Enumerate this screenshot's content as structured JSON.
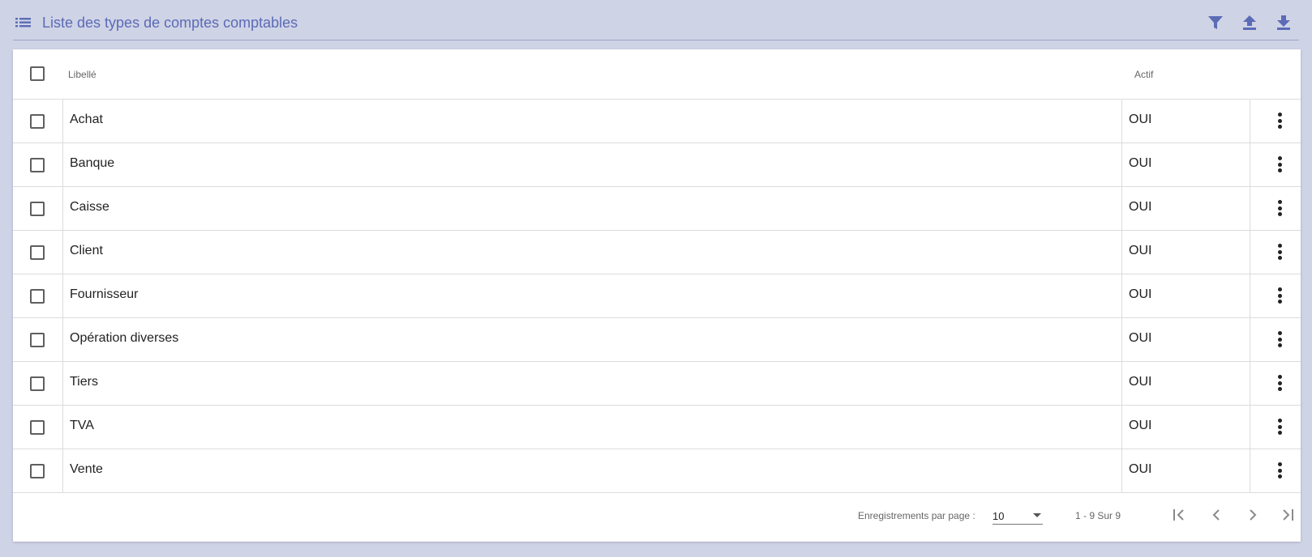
{
  "header": {
    "title": "Liste des types de comptes comptables",
    "icons": [
      "list-icon",
      "filter-icon",
      "upload-icon",
      "download-icon"
    ],
    "accent": "#5b6bb6"
  },
  "table": {
    "columns": [
      "Libellé",
      "Actif"
    ],
    "rows": [
      {
        "label": "Achat",
        "active": "OUI"
      },
      {
        "label": "Banque",
        "active": "OUI"
      },
      {
        "label": "Caisse",
        "active": "OUI"
      },
      {
        "label": "Client",
        "active": "OUI"
      },
      {
        "label": "Fournisseur",
        "active": "OUI"
      },
      {
        "label": "Opération diverses",
        "active": "OUI"
      },
      {
        "label": "Tiers",
        "active": "OUI"
      },
      {
        "label": "TVA",
        "active": "OUI"
      },
      {
        "label": "Vente",
        "active": "OUI"
      }
    ]
  },
  "paginator": {
    "rows_per_page_label": "Enregistrements par page :",
    "rows_per_page_value": "10",
    "range_label": "1 - 9 Sur 9",
    "icons": [
      "first-page-icon",
      "previous-page-icon",
      "next-page-icon",
      "last-page-icon"
    ]
  }
}
